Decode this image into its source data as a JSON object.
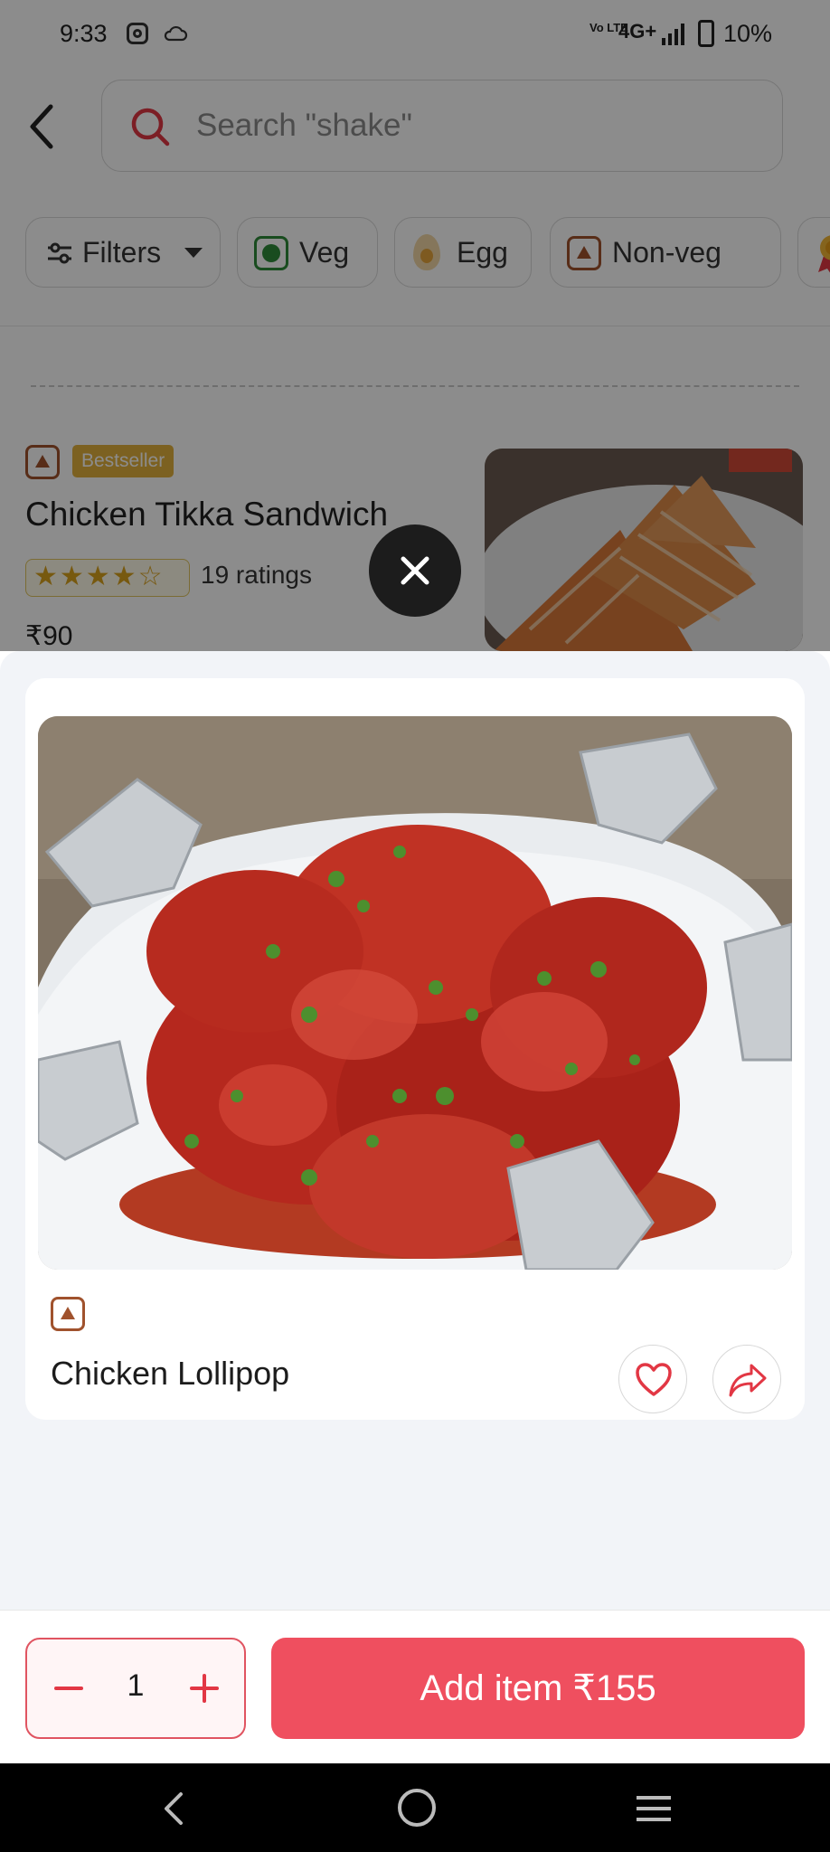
{
  "status_bar": {
    "time": "9:33",
    "volte": "Vo LTE",
    "network": "4G+",
    "battery": "10%"
  },
  "search": {
    "placeholder": "Search \"shake\""
  },
  "filter_chips": [
    {
      "label": "Filters"
    },
    {
      "label": "Veg"
    },
    {
      "label": "Egg"
    },
    {
      "label": "Non-veg"
    }
  ],
  "background_item": {
    "badge": "Bestseller",
    "name": "Chicken Tikka Sandwich",
    "stars": "★★★★☆",
    "rating_count": "19 ratings",
    "price": "₹90"
  },
  "item_sheet": {
    "name": "Chicken Lollipop",
    "quantity": "1",
    "add_button": "Add item ₹155"
  },
  "colors": {
    "brand": "#ef4f5f",
    "veg": "#2e8b3a",
    "non_veg": "#a0522d",
    "bestseller": "#e2b13c"
  },
  "icons": [
    "back-arrow-icon",
    "search-icon",
    "filter-sliders-icon",
    "chevron-down-icon",
    "veg-icon",
    "egg-icon",
    "non-veg-icon",
    "award-icon",
    "close-icon",
    "heart-icon",
    "share-icon",
    "minus-icon",
    "plus-icon"
  ]
}
